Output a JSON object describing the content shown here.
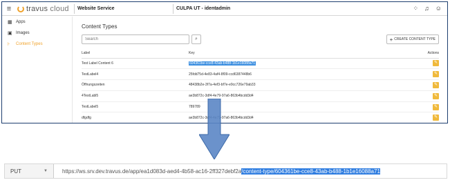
{
  "topbar": {
    "menu_icon": "hamburger-icon",
    "logo_text_1": "travus",
    "logo_text_2": "cloud",
    "service": "Website Service",
    "environment": "CULPA UT - identadmin",
    "icons": [
      "apps-grid-icon",
      "bell-icon",
      "account-icon"
    ]
  },
  "sidebar": {
    "items": [
      {
        "label": "Apps",
        "icon": "apps-icon"
      },
      {
        "label": "Images",
        "icon": "image-icon"
      },
      {
        "label": "Content Types",
        "icon": "content-types-icon"
      }
    ]
  },
  "main": {
    "title": "Content Types",
    "search_placeholder": "Search",
    "create_label": "CREATE CONTENT TYPE",
    "columns": [
      "Label",
      "Key",
      "Actions"
    ],
    "rows": [
      {
        "label": "Test Label Content 6",
        "key": "604361be-cce8-43ab-b488-1b1e16088a71"
      },
      {
        "label": "TestLabel4",
        "key": "25fdd75d-4e83-4af4-8f09-ccd6387448b6"
      },
      {
        "label": "Öffnungszeiten",
        "key": "48438b2e-3f7a-4ef3-bf7e-e9cc726e79ab33"
      },
      {
        "label": "4TestLabl5",
        "key": "ae3b872c-3df4-4e79-97a6-863b4bcdd3d4"
      },
      {
        "label": "TestLabel5",
        "key": "789789"
      },
      {
        "label": "dfgdfg",
        "key": "ae3b872c-3df4-4e79-97a6-863b4bcdd3d4"
      }
    ]
  },
  "request": {
    "method": "PUT",
    "url_base": "https://ws.srv.dev.travus.de/app/ea1d083d-aed4-4b58-ac16-2ff327debf2a",
    "url_highlight": "/content-type/604361be-cce8-43ab-b488-1b1e16088a71"
  },
  "colors": {
    "accent": "#f0a22a",
    "selection": "#3d8fe0",
    "arrow": "#5b86c5",
    "frame_border": "#1c3d6e"
  }
}
